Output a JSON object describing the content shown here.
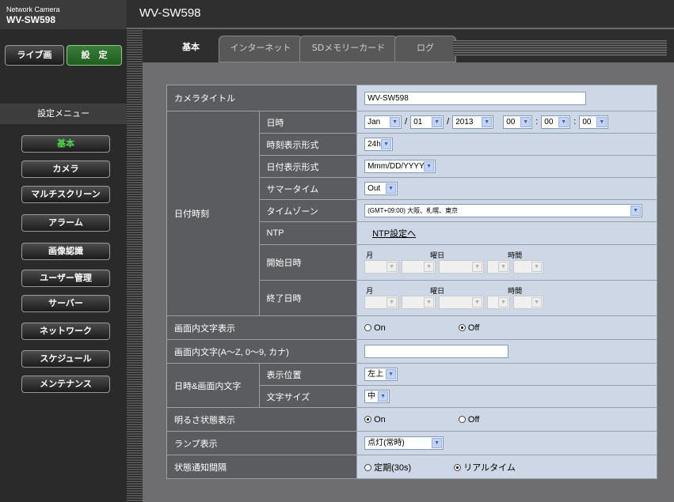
{
  "header": {
    "brand_line1": "Network Camera",
    "brand_line2": "WV-SW598",
    "model": "WV-SW598"
  },
  "sidebar": {
    "live_label": "ライブ画",
    "setup_label": "設　定",
    "menu_heading": "設定メニュー",
    "items": [
      {
        "label": "基本",
        "active": true
      },
      {
        "label": "カメラ"
      },
      {
        "label": "マルチスクリーン"
      },
      {
        "label": "アラーム"
      },
      {
        "label": "画像認識"
      },
      {
        "label": "ユーザー管理"
      },
      {
        "label": "サーバー"
      },
      {
        "label": "ネットワーク"
      },
      {
        "label": "スケジュール"
      },
      {
        "label": "メンテナンス"
      }
    ]
  },
  "tabs": [
    "基本",
    "インターネット",
    "SDメモリーカード",
    "ログ"
  ],
  "form": {
    "camera_title": {
      "label": "カメラタイトル",
      "value": "WV-SW598"
    },
    "datetime_group": "日付時刻",
    "datetime": {
      "label": "日時",
      "month": "Jan",
      "day": "01",
      "year": "2013",
      "hour": "00",
      "minute": "00",
      "second": "00",
      "sep_slash": "/",
      "sep_colon": ":"
    },
    "time_format": {
      "label": "時刻表示形式",
      "value": "24h"
    },
    "date_format": {
      "label": "日付表示形式",
      "value": "Mmm/DD/YYYY"
    },
    "summer_time": {
      "label": "サマータイム",
      "value": "Out"
    },
    "timezone": {
      "label": "タイムゾーン",
      "value": "(GMT+09:00) 大阪、札幌、東京"
    },
    "ntp": {
      "label": "NTP",
      "link": "NTP設定へ"
    },
    "start_dt": {
      "label": "開始日時",
      "h_month": "月",
      "h_weekday": "曜日",
      "h_time": "時間"
    },
    "end_dt": {
      "label": "終了日時",
      "h_month": "月",
      "h_weekday": "曜日",
      "h_time": "時間"
    },
    "osd_display": {
      "label": "画面内文字表示",
      "on": "On",
      "off": "Off",
      "selected": "Off"
    },
    "osd_text": {
      "label": "画面内文字(A〜Z, 0〜9, カナ)",
      "value": ""
    },
    "dt_osd_group": "日時&画面内文字",
    "position": {
      "label": "表示位置",
      "value": "左上"
    },
    "text_size": {
      "label": "文字サイズ",
      "value": "中"
    },
    "brightness": {
      "label": "明るさ状態表示",
      "on": "On",
      "off": "Off",
      "selected": "On"
    },
    "lamp": {
      "label": "ランプ表示",
      "value": "点灯(常時)"
    },
    "status_notify": {
      "label": "状態通知間隔",
      "opt1": "定期(30s)",
      "opt2": "リアルタイム",
      "selected": "リアルタイム"
    }
  }
}
